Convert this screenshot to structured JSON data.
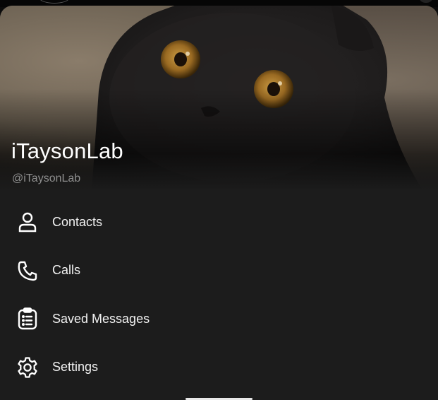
{
  "profile": {
    "name": "iTaysonLab",
    "handle": "@iTaysonLab"
  },
  "menu": {
    "items": [
      {
        "label": "Contacts",
        "icon": "person-icon"
      },
      {
        "label": "Calls",
        "icon": "phone-icon"
      },
      {
        "label": "Saved Messages",
        "icon": "saved-messages-icon"
      },
      {
        "label": "Settings",
        "icon": "gear-icon"
      }
    ]
  },
  "colors": {
    "drawer_background": "#1c1c1c",
    "text_primary": "#ffffff",
    "text_secondary": "#8f8f8f"
  }
}
